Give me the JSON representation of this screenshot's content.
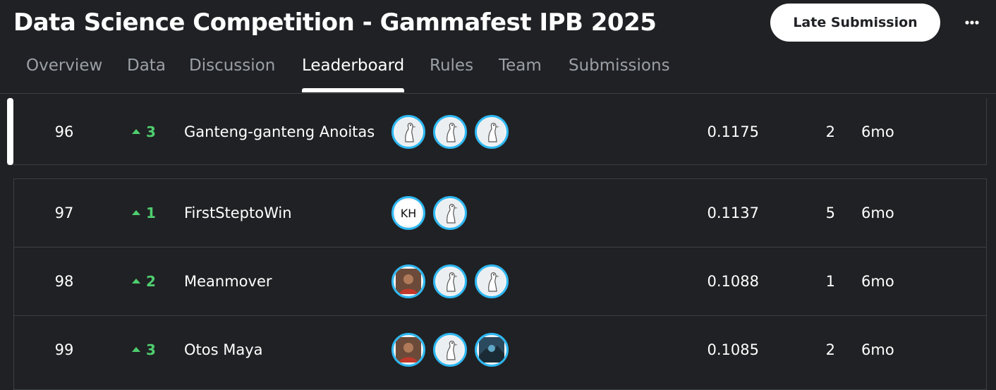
{
  "header": {
    "title": "Data Science Competition - Gammafest IPB 2025",
    "late_submission_label": "Late Submission",
    "more_icon": "more-horizontal-icon"
  },
  "tabs": [
    {
      "label": "Overview",
      "active": false
    },
    {
      "label": "Data",
      "active": false
    },
    {
      "label": "Discussion",
      "active": false
    },
    {
      "label": "Leaderboard",
      "active": true
    },
    {
      "label": "Rules",
      "active": false
    },
    {
      "label": "Team",
      "active": false
    },
    {
      "label": "Submissions",
      "active": false
    }
  ],
  "rows": [
    {
      "rank": "96",
      "delta": "3",
      "team": "Ganteng-ganteng Anoitas",
      "avatars": [
        "goose-avatar-icon",
        "goose-avatar-icon",
        "goose-avatar-icon"
      ],
      "score": "0.1175",
      "entries": "2",
      "last": "6mo",
      "highlighted": true
    },
    {
      "rank": "97",
      "delta": "1",
      "team": "FirstSteptoWin",
      "avatars": [
        "kh-monogram-avatar-icon",
        "goose-avatar-icon"
      ],
      "score": "0.1137",
      "entries": "5",
      "last": "6mo",
      "highlighted": false
    },
    {
      "rank": "98",
      "delta": "2",
      "team": "Meanmover",
      "avatars": [
        "photo-avatar-icon",
        "goose-avatar-icon",
        "goose-avatar-icon"
      ],
      "score": "0.1088",
      "entries": "1",
      "last": "6mo",
      "highlighted": false
    },
    {
      "rank": "99",
      "delta": "3",
      "team": "Otos Maya",
      "avatars": [
        "photo-avatar-icon",
        "goose-avatar-icon",
        "landscape-avatar-icon"
      ],
      "score": "0.1085",
      "entries": "2",
      "last": "6mo",
      "highlighted": false
    }
  ],
  "colors": {
    "background": "#202124",
    "accent_green": "#4fce6f",
    "avatar_ring": "#2eb8f2"
  }
}
